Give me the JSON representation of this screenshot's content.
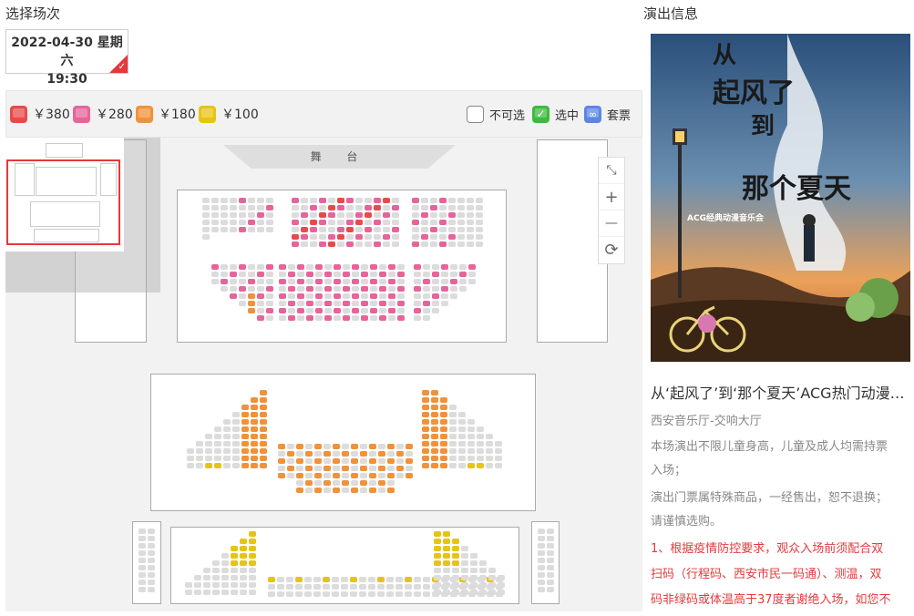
{
  "left": {
    "title": "选择场次",
    "session": {
      "date": "2022-04-30 星期六",
      "time": "19:30"
    },
    "prices": [
      {
        "label": "￥380",
        "color": "#e84a4a"
      },
      {
        "label": "￥280",
        "color": "#e6649a"
      },
      {
        "label": "￥180",
        "color": "#f0923a"
      },
      {
        "label": "￥100",
        "color": "#e6c416"
      }
    ],
    "legend": [
      {
        "label": "不可选",
        "icon": "seat-outline-icon"
      },
      {
        "label": "选中",
        "icon": "checkmark-icon"
      },
      {
        "label": "套票",
        "icon": "link-icon"
      }
    ],
    "stage_label": "舞 台",
    "zoom": {
      "fit": "⤡",
      "plus": "+",
      "minus": "—",
      "reset": "⟳"
    }
  },
  "right": {
    "title": "演出信息",
    "poster": {
      "headline_a": "从",
      "headline_b": "起风了",
      "headline_c": "到",
      "headline_d": "那个夏天",
      "subtitle": "ACG经典动漫音乐会"
    },
    "show_title": "从‘起风了’到‘那个夏天’ACG热门动漫音乐会",
    "venue": "西安音乐厅-交响大厅",
    "notice_lines": [
      "本场演出不限儿童身高，儿童及成人均需持票",
      "入场；",
      "演出门票属特殊商品，一经售出，恕不退换；",
      "请谨慎选购。"
    ],
    "red_lines": [
      "1、根据疫情防控要求，观众入场前须配合双",
      "扫码（行程码、西安市民一码通）、测温，双",
      "码非绿码或体温高于37度者谢绝入场，如您不"
    ]
  }
}
